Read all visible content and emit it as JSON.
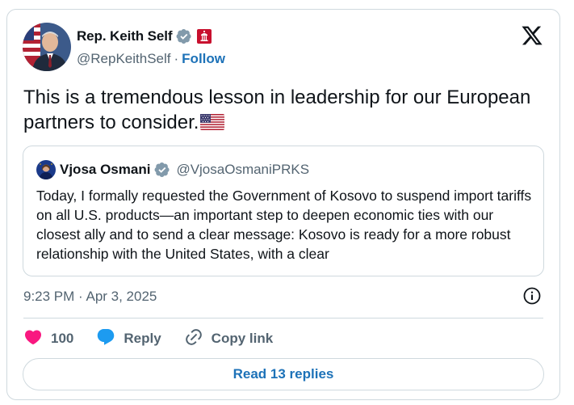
{
  "author": {
    "name": "Rep. Keith Self",
    "handle": "@RepKeithSelf",
    "separator": "·",
    "follow_label": "Follow"
  },
  "tweet": {
    "text": "This is a tremendous lesson in leadership for our European partners to consider."
  },
  "quoted": {
    "name": "Vjosa Osmani",
    "handle": "@VjosaOsmaniPRKS",
    "text": "Today, I formally requested the Government of Kosovo to suspend import tariffs on all U.S. products—an important step to deepen economic ties with our closest ally and to send a clear message: Kosovo is ready for a more robust relationship with the United States, with a clear"
  },
  "meta": {
    "timestamp": "9:23 PM · Apr 3, 2025"
  },
  "actions": {
    "likes": "100",
    "reply_label": "Reply",
    "copy_link_label": "Copy link"
  },
  "footer": {
    "read_replies_label": "Read 13 replies"
  },
  "colors": {
    "link_blue": "#1d72b8",
    "verified_gray": "#829aab",
    "like_pink": "#f91880",
    "reply_blue": "#1d9bf0",
    "muted_text": "#536471",
    "border": "#cfd9de"
  }
}
